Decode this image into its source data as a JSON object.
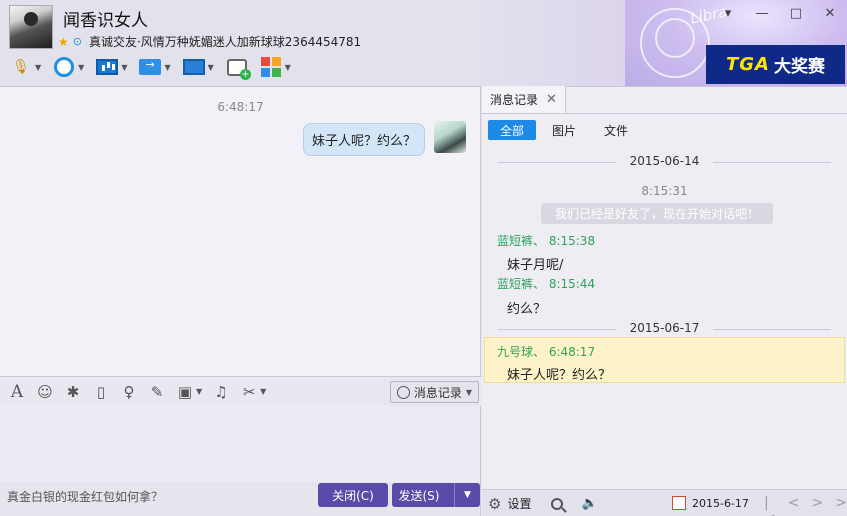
{
  "contact": {
    "name": "闻香识女人",
    "signature": "真诚交友·风情万种妩媚迷人加新球球2364454781"
  },
  "banner": {
    "logo": "TGA",
    "text": "大奖赛"
  },
  "header_art": {
    "text": "Libra"
  },
  "window_controls": {
    "settings": "▾",
    "minimize": "—",
    "maximize": "□",
    "close": "✕"
  },
  "chat": {
    "time": "6:48:17",
    "sent_message": "妹子人呢？约么？"
  },
  "input_toolbar": {
    "history_label": "消息记录"
  },
  "bottom": {
    "ad_text": "真金白银的现金红包如何拿？",
    "close_label": "关闭(C)",
    "send_label": "发送(S)"
  },
  "history_panel": {
    "tab_label": "消息记录",
    "filters": [
      "全部",
      "图片",
      "文件"
    ],
    "dates": [
      "2015-06-14",
      "2015-06-17"
    ],
    "system_time": "8:15:31",
    "system_message": "我们已经是好友了，现在开始对话吧！",
    "messages": [
      {
        "head": "蓝短裤、 8:15:38",
        "body": "妹子月呢/"
      },
      {
        "head": "蓝短裤、 8:15:44",
        "body": "约么？"
      },
      {
        "head": "九号球、 6:48:17",
        "body": "妹子人呢？约么？"
      }
    ],
    "settings_label": "设置",
    "current_date": "2015-6-17"
  },
  "colors": {
    "accent_purple": "#5b4aa8",
    "filter_active": "#1e88e5",
    "sender_green": "#2ea35a",
    "highlight": "#fdf2c8",
    "banner_bg": "#0f2a86"
  }
}
